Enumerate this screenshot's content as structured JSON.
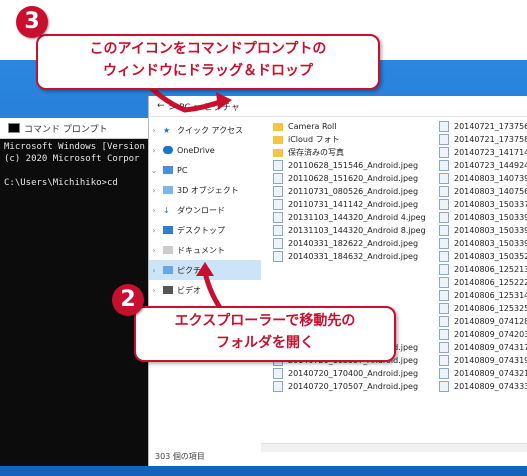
{
  "callouts": {
    "step3": {
      "num": "3",
      "line1": "このアイコンをコマンドプロンプトの",
      "line2": "ウィンドウにドラッグ＆ドロップ"
    },
    "step2": {
      "num": "2",
      "line1": "エクスプローラーで移動先の",
      "line2": "フォルダを開く"
    }
  },
  "cmd": {
    "title": "コマンド プロンプト",
    "lines": [
      "Microsoft Windows [Version",
      "(c) 2020 Microsoft Corpor",
      "",
      "C:\\Users\\Michihiko>cd"
    ]
  },
  "explorer": {
    "address": "> PC > ピクチャ",
    "nav": [
      {
        "label": "クイック アクセス"
      },
      {
        "label": "OneDrive"
      },
      {
        "label": "PC"
      },
      {
        "label": "3D オブジェクト"
      },
      {
        "label": "ダウンロード"
      },
      {
        "label": "デスクトップ"
      },
      {
        "label": "ドキュメント"
      },
      {
        "label": "ピクチャ"
      },
      {
        "label": "ビデオ"
      }
    ],
    "files_col1": [
      "Camera Roll",
      "iCloud フォト",
      "保存済みの写真",
      "20110628_151546_Android.jpeg",
      "20110628_151620_Android.jpeg",
      "20110731_080526_Android.jpeg",
      "20110731_141142_Android.jpeg",
      "20131103_144320_Android 4.jpeg",
      "20131103_144320_Android 8.jpeg",
      "20140331_182622_Android.jpeg",
      "20140331_184632_Android.jpeg",
      "",
      "",
      "",
      "",
      "",
      "",
      "20140719_095451_Android.jpeg",
      "20140720_103357_Android.jpeg",
      "20140720_170400_Android.jpeg",
      "20140720_170507_Android.jpeg"
    ],
    "files_col2": [
      "20140721_173756_An",
      "20140721_173758_An",
      "20140723_141714_An",
      "20140723_144924_An",
      "20140803_140739_An",
      "20140803_140756_An",
      "20140803_150337_An",
      "20140803_150339_An",
      "20140803_150339_An",
      "20140803_150339_An",
      "20140803_150352_An",
      "20140806_125213_An",
      "20140806_125222_An",
      "20140806_125314_An",
      "20140806_125325_An",
      "20140809_074128_An",
      "20140809_074203_An",
      "20140809_074317_An",
      "20140809_074319_An",
      "20140809_074321_An",
      "20140809_074333_An"
    ],
    "status": "303 個の項目"
  }
}
